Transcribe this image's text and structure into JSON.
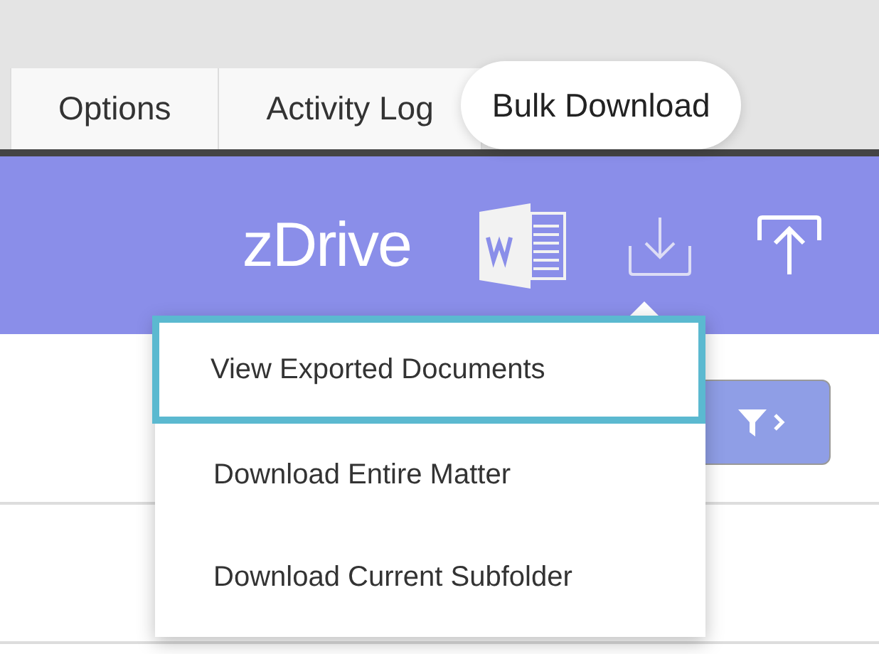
{
  "tabs": [
    {
      "label": "Options",
      "selected": false
    },
    {
      "label": "Activity Log",
      "selected": false
    },
    {
      "label": "Bulk Download",
      "selected": true
    }
  ],
  "header": {
    "logo": "zDrive"
  },
  "download_menu": {
    "open": true,
    "items": [
      {
        "label": "View Exported Documents",
        "selected": true
      },
      {
        "label": "Download Entire Matter",
        "selected": false
      },
      {
        "label": "Download Current Subfolder",
        "selected": false
      }
    ]
  }
}
